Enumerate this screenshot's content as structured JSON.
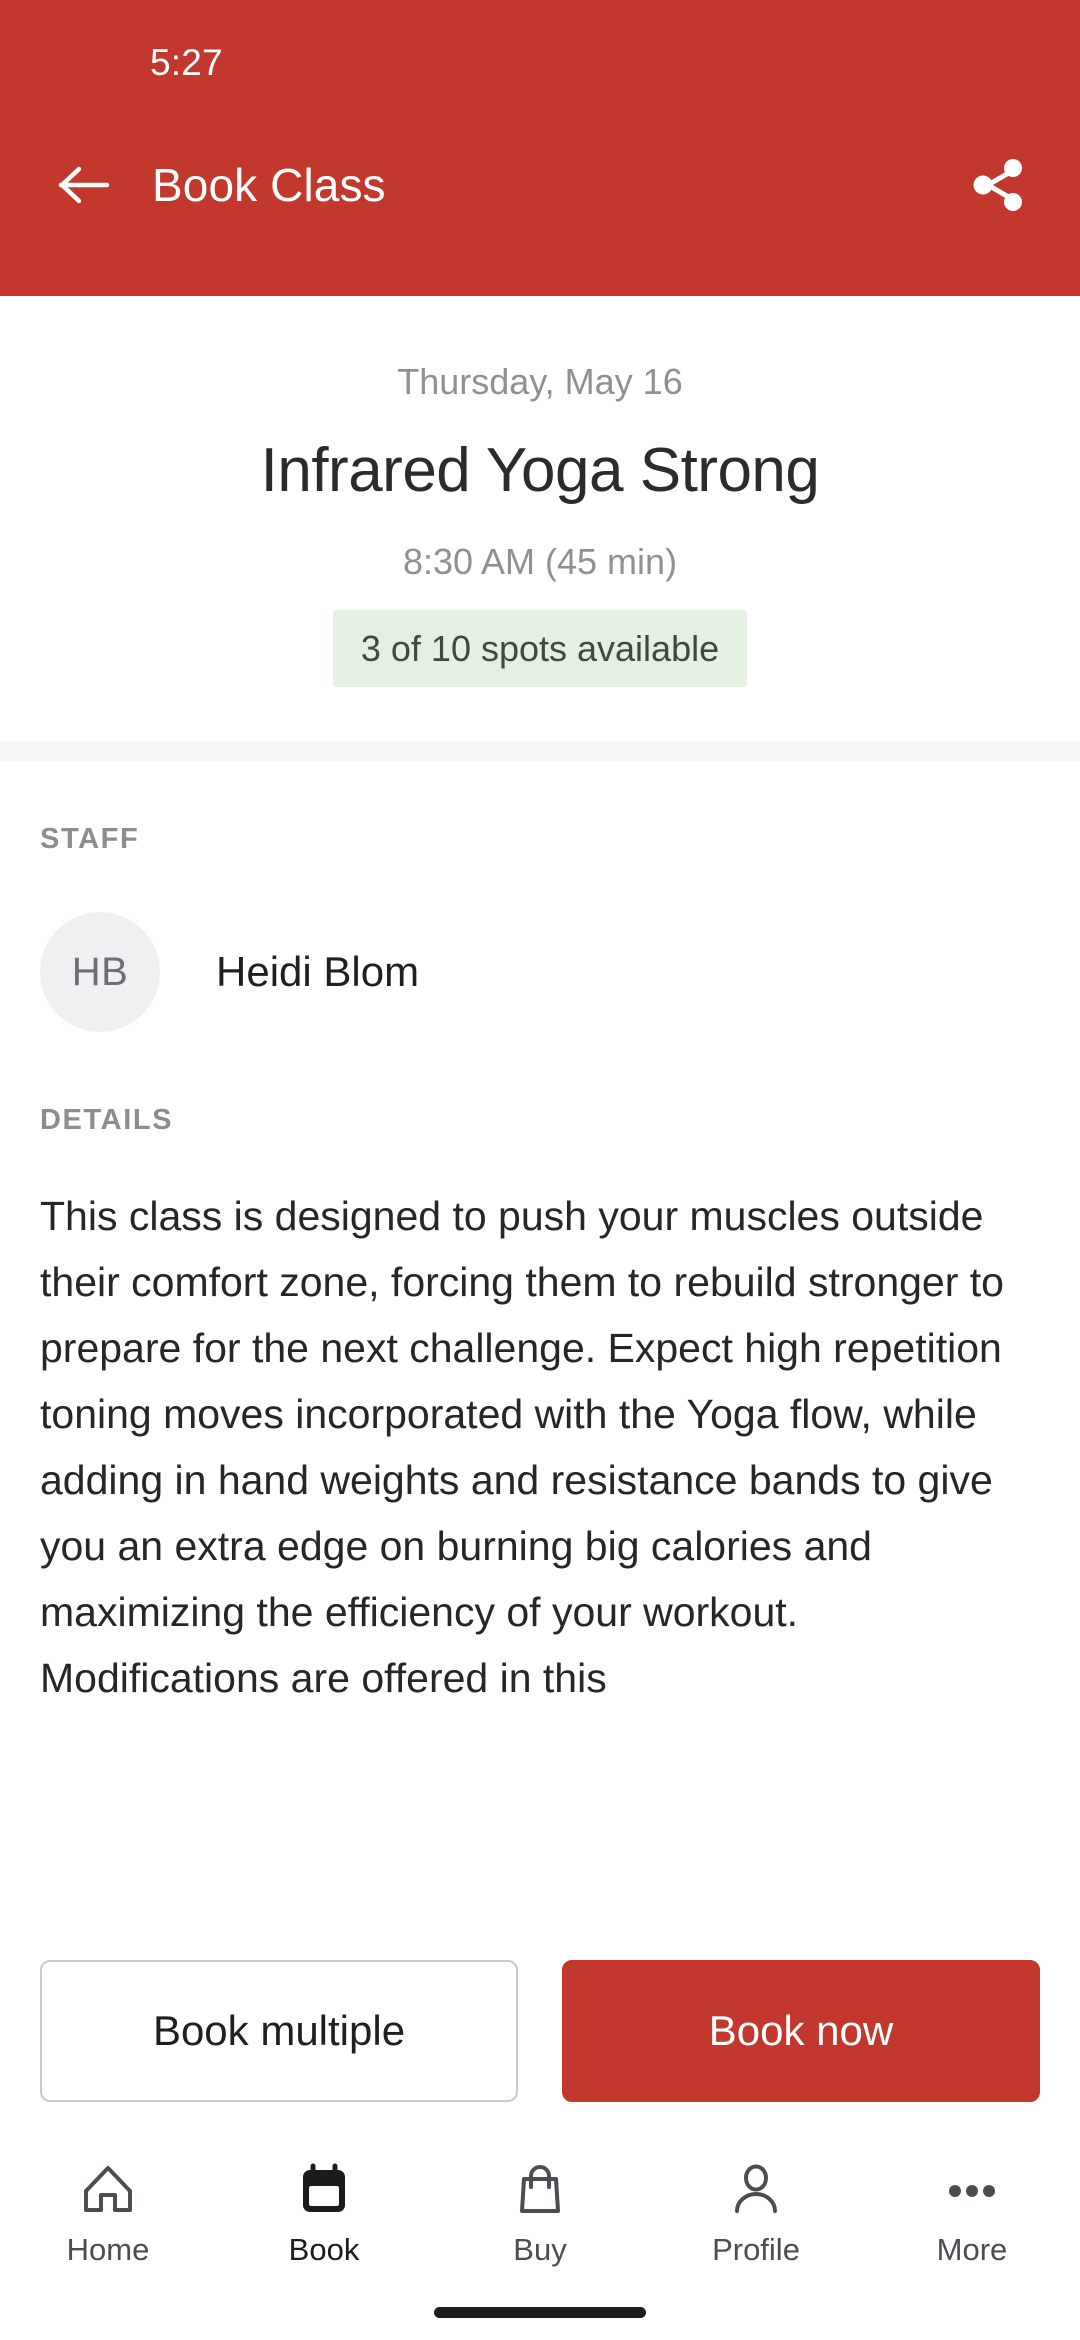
{
  "theme": {
    "brand_red": "#C3382D",
    "badge_green_bg": "#E3F0E2",
    "badge_green_text": "#3D4A3C",
    "muted_text": "#8E9094",
    "divider": "#F6F7F9"
  },
  "status_bar": {
    "time": "5:27"
  },
  "appbar": {
    "back_icon": "arrow-left-icon",
    "title": "Book Class",
    "share_icon": "share-icon"
  },
  "class": {
    "date": "Thursday, May 16",
    "name": "Infrared Yoga Strong",
    "time": "8:30 AM (45 min)",
    "availability": "3 of 10 spots available"
  },
  "staff": {
    "label": "STAFF",
    "members": [
      {
        "initials": "HB",
        "name": "Heidi Blom"
      }
    ]
  },
  "details": {
    "label": "DETAILS",
    "body": "This class is designed to push your muscles outside their comfort zone, forcing them to rebuild stronger to prepare for the next challenge. Expect high repetition toning moves incorporated with the Yoga flow, while adding in hand weights and resistance bands to give you an extra edge on burning big calories and maximizing the efficiency of your workout.  Modifications are offered in this"
  },
  "actions": {
    "secondary_label": "Book multiple",
    "primary_label": "Book now"
  },
  "bottom_nav": {
    "items": [
      {
        "label": "Home",
        "icon": "home-icon",
        "active": false
      },
      {
        "label": "Book",
        "icon": "calendar-icon",
        "active": true
      },
      {
        "label": "Buy",
        "icon": "bag-icon",
        "active": false
      },
      {
        "label": "Profile",
        "icon": "person-icon",
        "active": false
      },
      {
        "label": "More",
        "icon": "ellipsis-icon",
        "active": false
      }
    ]
  }
}
